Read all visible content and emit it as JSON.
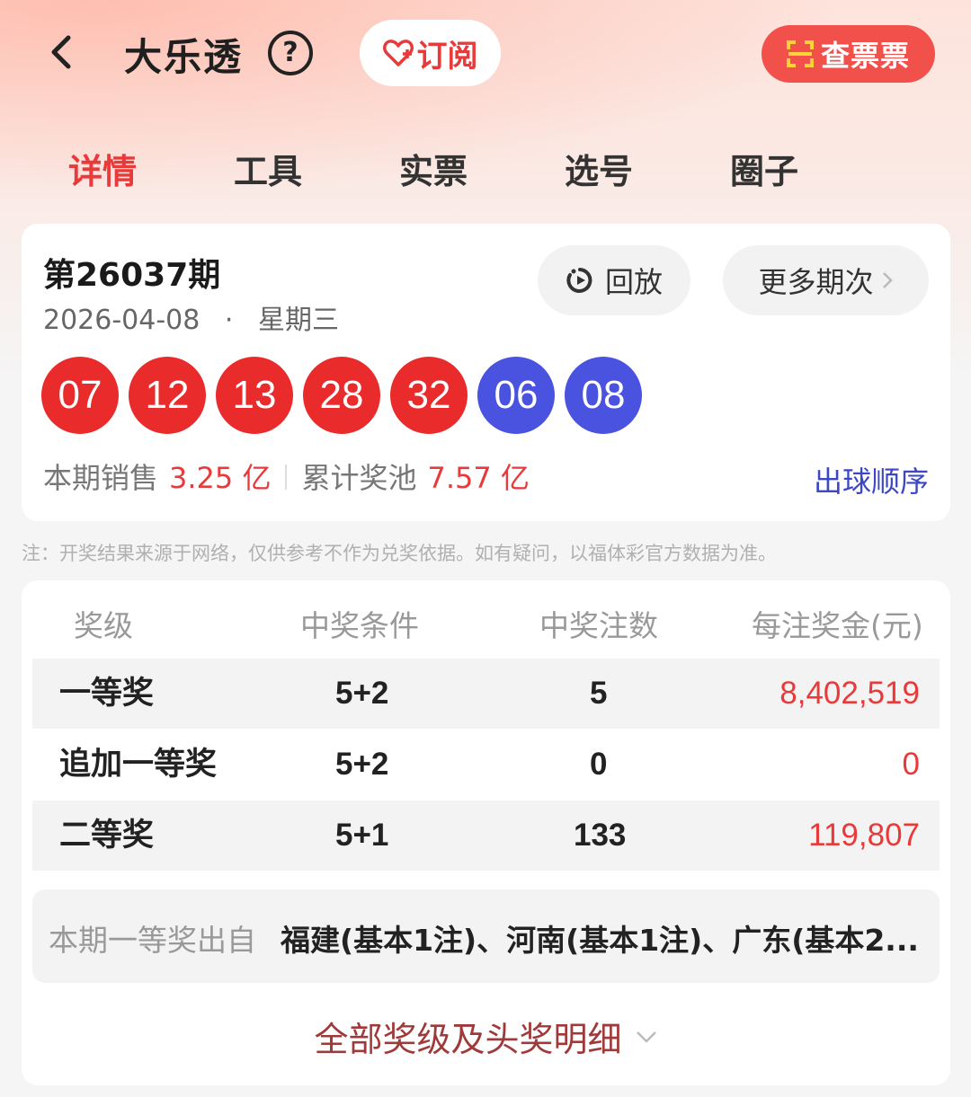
{
  "header": {
    "title": "大乐透",
    "help_glyph": "?",
    "subscribe_label": "订阅",
    "check_ticket_label": "查票票"
  },
  "tabs": [
    {
      "label": "详情",
      "active": true
    },
    {
      "label": "工具",
      "active": false
    },
    {
      "label": "实票",
      "active": false
    },
    {
      "label": "选号",
      "active": false
    },
    {
      "label": "圈子",
      "active": false
    }
  ],
  "draw": {
    "issue": "第26037期",
    "date": "2026-04-08",
    "weekday": "星期三",
    "replay_label": "回放",
    "more_label": "更多期次",
    "front_balls": [
      "07",
      "12",
      "13",
      "28",
      "32"
    ],
    "back_balls": [
      "06",
      "08"
    ],
    "sales_label": "本期销售",
    "sales_value": "3.25 亿",
    "pool_label": "累计奖池",
    "pool_value": "7.57 亿",
    "order_link": "出球顺序"
  },
  "note": "注：开奖结果来源于网络，仅供参考不作为兑奖依据。如有疑问，以福体彩官方数据为准。",
  "prizes": {
    "headers": [
      "奖级",
      "中奖条件",
      "中奖注数",
      "每注奖金(元)"
    ],
    "rows": [
      {
        "level": "一等奖",
        "condition": "5+2",
        "count": "5",
        "amount": "8,402,519"
      },
      {
        "level": "追加一等奖",
        "condition": "5+2",
        "count": "0",
        "amount": "0"
      },
      {
        "level": "二等奖",
        "condition": "5+1",
        "count": "133",
        "amount": "119,807"
      }
    ],
    "origin_label": "本期一等奖出自",
    "origin_value": "福建(基本1注)、河南(基本1注)、广东(基本2...",
    "all_link": "全部奖级及头奖明细"
  },
  "colors": {
    "accent_red": "#e83a3a",
    "ball_red": "#ea2b2b",
    "ball_blue": "#4a52e0",
    "link_blue": "#3b47c4"
  }
}
